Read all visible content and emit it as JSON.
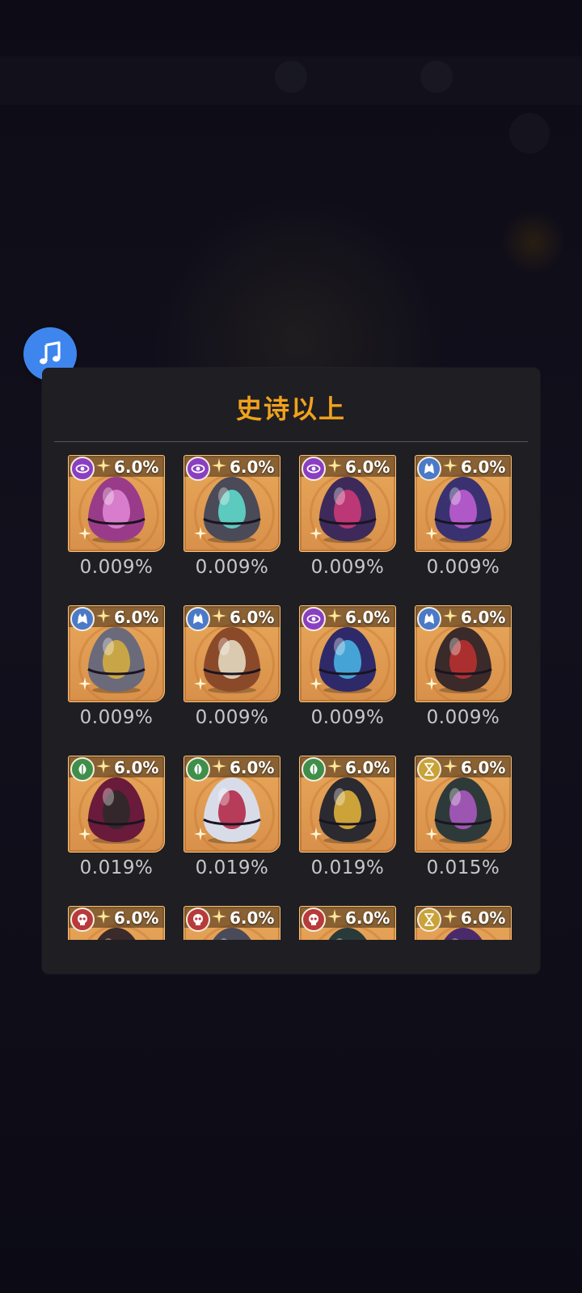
{
  "panel": {
    "title": "史诗以上"
  },
  "items": [
    {
      "faction": "eye-icon",
      "faction_color": "#8a3fc2",
      "egg_main": "#9a3b8a",
      "egg_accent": "#e28ad6",
      "badge": "6.0%",
      "rate": "0.009%"
    },
    {
      "faction": "eye-icon",
      "faction_color": "#8a3fc2",
      "egg_main": "#4a4a58",
      "egg_accent": "#5fe0d0",
      "badge": "6.0%",
      "rate": "0.009%"
    },
    {
      "faction": "eye-icon",
      "faction_color": "#8a3fc2",
      "egg_main": "#3d2a5a",
      "egg_accent": "#d23a7a",
      "badge": "6.0%",
      "rate": "0.009%"
    },
    {
      "faction": "wolf-icon",
      "faction_color": "#4a7ac8",
      "egg_main": "#3a3270",
      "egg_accent": "#c55fd6",
      "badge": "6.0%",
      "rate": "0.009%"
    },
    {
      "faction": "wolf-icon",
      "faction_color": "#4a7ac8",
      "egg_main": "#6a6a7a",
      "egg_accent": "#d8b040",
      "badge": "6.0%",
      "rate": "0.009%"
    },
    {
      "faction": "wolf-icon",
      "faction_color": "#4a7ac8",
      "egg_main": "#8a4a2a",
      "egg_accent": "#e8e0c8",
      "badge": "6.0%",
      "rate": "0.009%"
    },
    {
      "faction": "eye-icon",
      "faction_color": "#8a3fc2",
      "egg_main": "#2e2a6a",
      "egg_accent": "#4ab8e8",
      "badge": "6.0%",
      "rate": "0.009%"
    },
    {
      "faction": "wolf-icon",
      "faction_color": "#4a7ac8",
      "egg_main": "#3a2a2a",
      "egg_accent": "#c03030",
      "badge": "6.0%",
      "rate": "0.009%"
    },
    {
      "faction": "leaf-icon",
      "faction_color": "#3f8f4a",
      "egg_main": "#6a1a3a",
      "egg_accent": "#2a2a2a",
      "badge": "6.0%",
      "rate": "0.019%"
    },
    {
      "faction": "leaf-icon",
      "faction_color": "#3f8f4a",
      "egg_main": "#d8dce8",
      "egg_accent": "#b02040",
      "badge": "6.0%",
      "rate": "0.019%"
    },
    {
      "faction": "leaf-icon",
      "faction_color": "#3f8f4a",
      "egg_main": "#2a2a30",
      "egg_accent": "#e8b83a",
      "badge": "6.0%",
      "rate": "0.019%"
    },
    {
      "faction": "hourglass-icon",
      "faction_color": "#c9a23a",
      "egg_main": "#2e3a3a",
      "egg_accent": "#b05ac8",
      "badge": "6.0%",
      "rate": "0.015%"
    },
    {
      "faction": "skull-icon",
      "faction_color": "#b83a3a",
      "egg_main": "#3a2a2a",
      "egg_accent": "#c03030",
      "badge": "6.0%",
      "rate": ""
    },
    {
      "faction": "skull-icon",
      "faction_color": "#b83a3a",
      "egg_main": "#4a4a58",
      "egg_accent": "#e8e8f0",
      "badge": "6.0%",
      "rate": ""
    },
    {
      "faction": "skull-icon",
      "faction_color": "#b83a3a",
      "egg_main": "#2a3a3a",
      "egg_accent": "#8aa0a0",
      "badge": "6.0%",
      "rate": ""
    },
    {
      "faction": "hourglass-icon",
      "faction_color": "#c9a23a",
      "egg_main": "#4a2a6a",
      "egg_accent": "#b05ac8",
      "badge": "6.0%",
      "rate": ""
    }
  ]
}
